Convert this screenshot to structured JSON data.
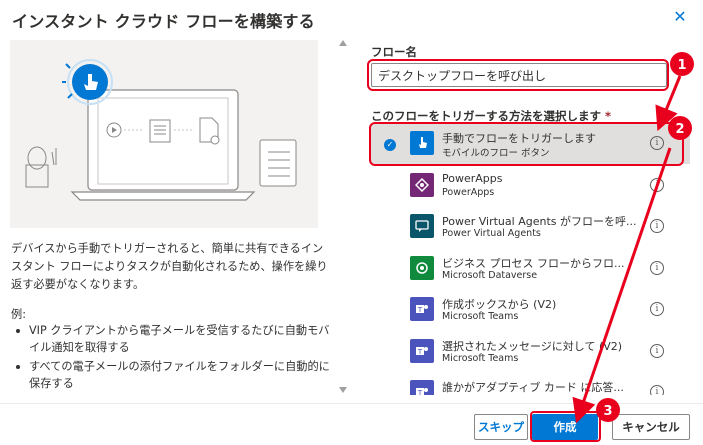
{
  "dialog": {
    "title": "インスタント クラウド フローを構築する",
    "close_icon": "close-icon"
  },
  "left": {
    "description": "デバイスから手動でトリガーされると、簡単に共有できるインスタント フローによりタスクが自動化されるため、操作を繰り返す必要がなくなります。",
    "examples_title": "例:",
    "examples": [
      "VIP クライアントから電子メールを受信するたびに自動モバイル通知を取得する",
      "すべての電子メールの添付ファイルをフォルダーに自動的に保存する"
    ]
  },
  "form": {
    "flow_name_label": "フロー名",
    "flow_name_value": "デスクトップフローを呼び出し",
    "trigger_label": "このフローをトリガーする方法を選択します",
    "required_mark": "*"
  },
  "triggers": [
    {
      "name": "手動でフローをトリガーします",
      "sub": "モバイルのフロー ボタン",
      "icon": "hand-touch-icon",
      "color": "#0078d4",
      "selected": true
    },
    {
      "name": "PowerApps",
      "sub": "PowerApps",
      "icon": "powerapps-icon",
      "color": "#742774",
      "selected": false
    },
    {
      "name": "Power Virtual Agents がフローを呼...",
      "sub": "Power Virtual Agents",
      "icon": "chat-bot-icon",
      "color": "#0b556a",
      "selected": false
    },
    {
      "name": "ビジネス プロセス フローからフロ...",
      "sub": "Microsoft Dataverse",
      "icon": "dataverse-icon",
      "color": "#108a3c",
      "selected": false
    },
    {
      "name": "作成ボックスから (V2)",
      "sub": "Microsoft Teams",
      "icon": "teams-icon",
      "color": "#4b53bc",
      "selected": false
    },
    {
      "name": "選択されたメッセージに対して (V2)",
      "sub": "Microsoft Teams",
      "icon": "teams-icon",
      "color": "#4b53bc",
      "selected": false
    },
    {
      "name": "誰かがアダプティブ カード に応答...",
      "sub": "",
      "icon": "teams-icon",
      "color": "#4b53bc",
      "selected": false
    }
  ],
  "footer": {
    "skip_label": "スキップ",
    "create_label": "作成",
    "cancel_label": "キャンセル"
  },
  "annotations": [
    "1",
    "2",
    "3"
  ],
  "colors": {
    "accent": "#0078d4",
    "annotation": "#e8001c"
  }
}
